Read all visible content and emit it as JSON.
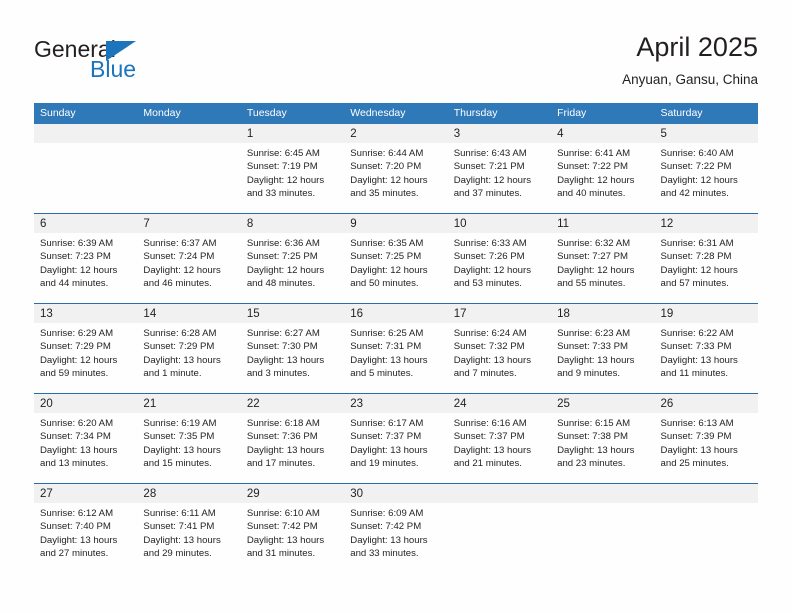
{
  "brand": {
    "name_top": "General",
    "name_bottom": "Blue",
    "accent_color": "#1c75bc"
  },
  "header": {
    "title": "April 2025",
    "subtitle": "Anyuan, Gansu, China"
  },
  "theme": {
    "header_row_bg": "#3079b9",
    "row_border": "#2b6cab",
    "day_band_bg": "#f1f1f1",
    "text": "#231f20"
  },
  "weekdays": [
    "Sunday",
    "Monday",
    "Tuesday",
    "Wednesday",
    "Thursday",
    "Friday",
    "Saturday"
  ],
  "labels": {
    "sunrise": "Sunrise:",
    "sunset": "Sunset:",
    "daylight": "Daylight:"
  },
  "weeks": [
    [
      {
        "day": "",
        "sunrise": "",
        "sunset": "",
        "daylight": ""
      },
      {
        "day": "",
        "sunrise": "",
        "sunset": "",
        "daylight": ""
      },
      {
        "day": "1",
        "sunrise": "Sunrise: 6:45 AM",
        "sunset": "Sunset: 7:19 PM",
        "daylight": "Daylight: 12 hours and 33 minutes."
      },
      {
        "day": "2",
        "sunrise": "Sunrise: 6:44 AM",
        "sunset": "Sunset: 7:20 PM",
        "daylight": "Daylight: 12 hours and 35 minutes."
      },
      {
        "day": "3",
        "sunrise": "Sunrise: 6:43 AM",
        "sunset": "Sunset: 7:21 PM",
        "daylight": "Daylight: 12 hours and 37 minutes."
      },
      {
        "day": "4",
        "sunrise": "Sunrise: 6:41 AM",
        "sunset": "Sunset: 7:22 PM",
        "daylight": "Daylight: 12 hours and 40 minutes."
      },
      {
        "day": "5",
        "sunrise": "Sunrise: 6:40 AM",
        "sunset": "Sunset: 7:22 PM",
        "daylight": "Daylight: 12 hours and 42 minutes."
      }
    ],
    [
      {
        "day": "6",
        "sunrise": "Sunrise: 6:39 AM",
        "sunset": "Sunset: 7:23 PM",
        "daylight": "Daylight: 12 hours and 44 minutes."
      },
      {
        "day": "7",
        "sunrise": "Sunrise: 6:37 AM",
        "sunset": "Sunset: 7:24 PM",
        "daylight": "Daylight: 12 hours and 46 minutes."
      },
      {
        "day": "8",
        "sunrise": "Sunrise: 6:36 AM",
        "sunset": "Sunset: 7:25 PM",
        "daylight": "Daylight: 12 hours and 48 minutes."
      },
      {
        "day": "9",
        "sunrise": "Sunrise: 6:35 AM",
        "sunset": "Sunset: 7:25 PM",
        "daylight": "Daylight: 12 hours and 50 minutes."
      },
      {
        "day": "10",
        "sunrise": "Sunrise: 6:33 AM",
        "sunset": "Sunset: 7:26 PM",
        "daylight": "Daylight: 12 hours and 53 minutes."
      },
      {
        "day": "11",
        "sunrise": "Sunrise: 6:32 AM",
        "sunset": "Sunset: 7:27 PM",
        "daylight": "Daylight: 12 hours and 55 minutes."
      },
      {
        "day": "12",
        "sunrise": "Sunrise: 6:31 AM",
        "sunset": "Sunset: 7:28 PM",
        "daylight": "Daylight: 12 hours and 57 minutes."
      }
    ],
    [
      {
        "day": "13",
        "sunrise": "Sunrise: 6:29 AM",
        "sunset": "Sunset: 7:29 PM",
        "daylight": "Daylight: 12 hours and 59 minutes."
      },
      {
        "day": "14",
        "sunrise": "Sunrise: 6:28 AM",
        "sunset": "Sunset: 7:29 PM",
        "daylight": "Daylight: 13 hours and 1 minute."
      },
      {
        "day": "15",
        "sunrise": "Sunrise: 6:27 AM",
        "sunset": "Sunset: 7:30 PM",
        "daylight": "Daylight: 13 hours and 3 minutes."
      },
      {
        "day": "16",
        "sunrise": "Sunrise: 6:25 AM",
        "sunset": "Sunset: 7:31 PM",
        "daylight": "Daylight: 13 hours and 5 minutes."
      },
      {
        "day": "17",
        "sunrise": "Sunrise: 6:24 AM",
        "sunset": "Sunset: 7:32 PM",
        "daylight": "Daylight: 13 hours and 7 minutes."
      },
      {
        "day": "18",
        "sunrise": "Sunrise: 6:23 AM",
        "sunset": "Sunset: 7:33 PM",
        "daylight": "Daylight: 13 hours and 9 minutes."
      },
      {
        "day": "19",
        "sunrise": "Sunrise: 6:22 AM",
        "sunset": "Sunset: 7:33 PM",
        "daylight": "Daylight: 13 hours and 11 minutes."
      }
    ],
    [
      {
        "day": "20",
        "sunrise": "Sunrise: 6:20 AM",
        "sunset": "Sunset: 7:34 PM",
        "daylight": "Daylight: 13 hours and 13 minutes."
      },
      {
        "day": "21",
        "sunrise": "Sunrise: 6:19 AM",
        "sunset": "Sunset: 7:35 PM",
        "daylight": "Daylight: 13 hours and 15 minutes."
      },
      {
        "day": "22",
        "sunrise": "Sunrise: 6:18 AM",
        "sunset": "Sunset: 7:36 PM",
        "daylight": "Daylight: 13 hours and 17 minutes."
      },
      {
        "day": "23",
        "sunrise": "Sunrise: 6:17 AM",
        "sunset": "Sunset: 7:37 PM",
        "daylight": "Daylight: 13 hours and 19 minutes."
      },
      {
        "day": "24",
        "sunrise": "Sunrise: 6:16 AM",
        "sunset": "Sunset: 7:37 PM",
        "daylight": "Daylight: 13 hours and 21 minutes."
      },
      {
        "day": "25",
        "sunrise": "Sunrise: 6:15 AM",
        "sunset": "Sunset: 7:38 PM",
        "daylight": "Daylight: 13 hours and 23 minutes."
      },
      {
        "day": "26",
        "sunrise": "Sunrise: 6:13 AM",
        "sunset": "Sunset: 7:39 PM",
        "daylight": "Daylight: 13 hours and 25 minutes."
      }
    ],
    [
      {
        "day": "27",
        "sunrise": "Sunrise: 6:12 AM",
        "sunset": "Sunset: 7:40 PM",
        "daylight": "Daylight: 13 hours and 27 minutes."
      },
      {
        "day": "28",
        "sunrise": "Sunrise: 6:11 AM",
        "sunset": "Sunset: 7:41 PM",
        "daylight": "Daylight: 13 hours and 29 minutes."
      },
      {
        "day": "29",
        "sunrise": "Sunrise: 6:10 AM",
        "sunset": "Sunset: 7:42 PM",
        "daylight": "Daylight: 13 hours and 31 minutes."
      },
      {
        "day": "30",
        "sunrise": "Sunrise: 6:09 AM",
        "sunset": "Sunset: 7:42 PM",
        "daylight": "Daylight: 13 hours and 33 minutes."
      },
      {
        "day": "",
        "sunrise": "",
        "sunset": "",
        "daylight": ""
      },
      {
        "day": "",
        "sunrise": "",
        "sunset": "",
        "daylight": ""
      },
      {
        "day": "",
        "sunrise": "",
        "sunset": "",
        "daylight": ""
      }
    ]
  ]
}
